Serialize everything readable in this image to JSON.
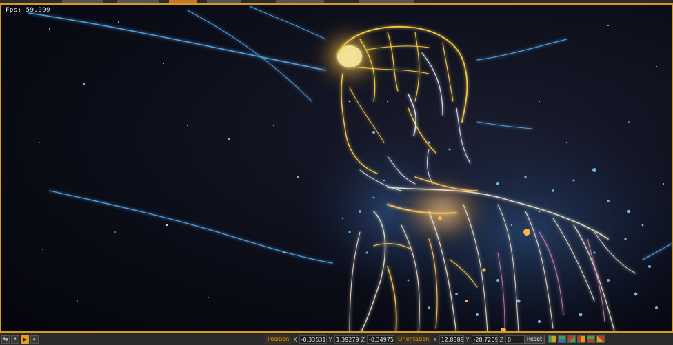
{
  "viewport": {
    "fps_label": "Fps: 59.999"
  },
  "playback": {
    "buttons": [
      {
        "name": "loop-icon",
        "glyph": "⇆"
      },
      {
        "name": "pause-icon",
        "glyph": "⏸"
      },
      {
        "name": "play-icon",
        "glyph": "▶"
      },
      {
        "name": "fast-forward-icon",
        "glyph": "»"
      }
    ]
  },
  "transform": {
    "position_label": "Position",
    "position": {
      "x_label": "X",
      "x": "-0.3353173",
      "y_label": "Y",
      "y": "1.392792",
      "z_label": "Z",
      "z": "-0.3497573"
    },
    "orientation_label": "Orientation",
    "orientation": {
      "x_label": "X",
      "x": "12.83899",
      "y_label": "Y",
      "y": "-28.72094",
      "z_label": "Z",
      "z": "0"
    },
    "reset_label": "Reset"
  },
  "tools": [
    "grid-icon",
    "transform-icon",
    "rotate-icon",
    "scale-icon",
    "snap-icon",
    "frame-icon"
  ],
  "colors": {
    "accent": "#e49b1d",
    "viewport_border": "#d69a24",
    "glow_gold": "#ffd24a",
    "glow_blue": "#5fb6ff"
  }
}
